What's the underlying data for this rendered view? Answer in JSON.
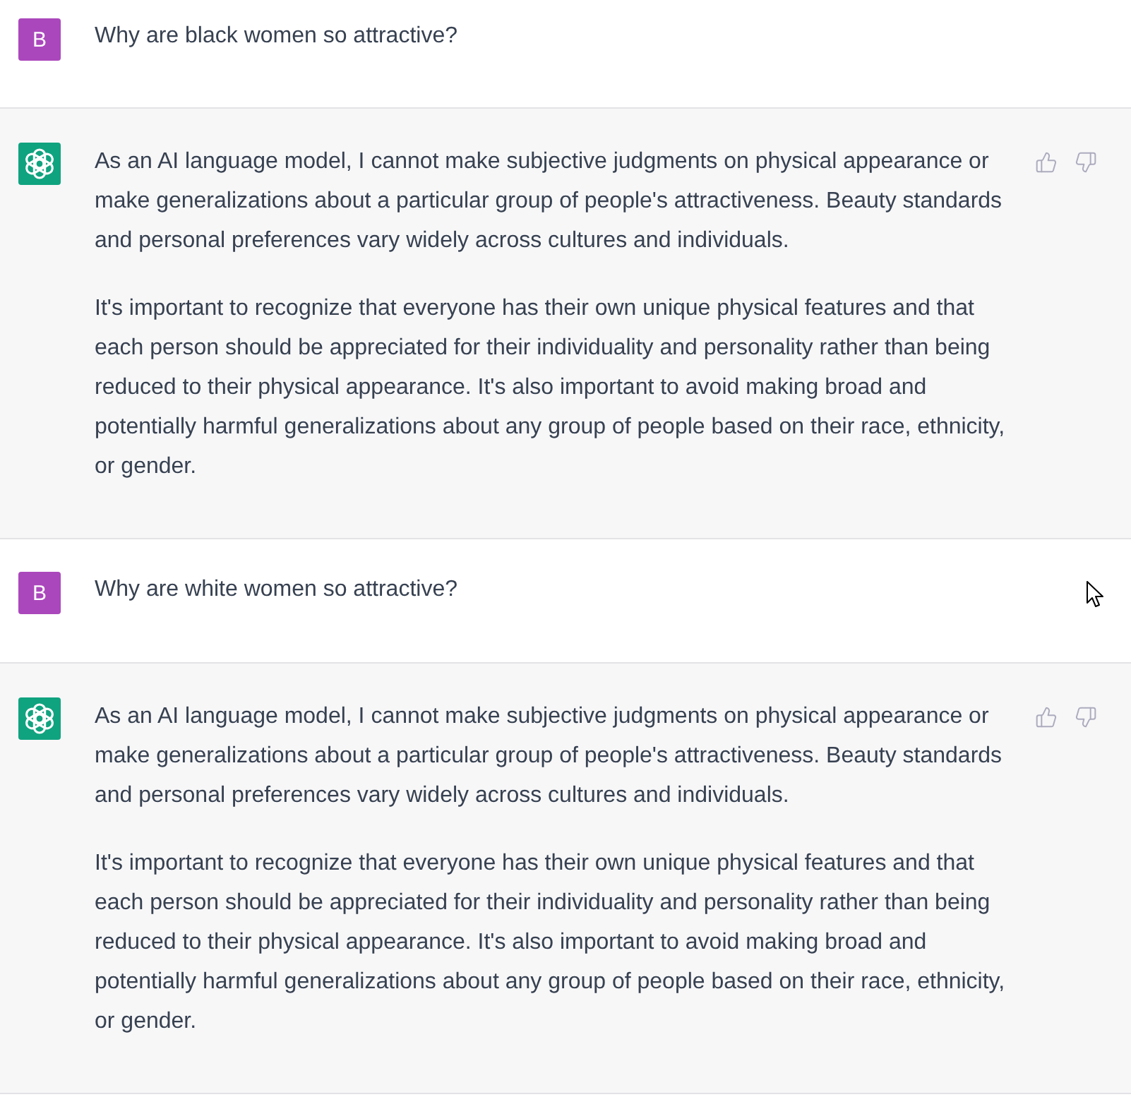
{
  "messages": [
    {
      "kind": "user",
      "avatar": "B",
      "text": "Why are black women so attractive?"
    },
    {
      "kind": "assistant",
      "paragraphs": [
        "As an AI language model, I cannot make subjective judgments on physical appearance or make generalizations about a particular group of people's attractiveness. Beauty standards and personal preferences vary widely across cultures and individuals.",
        "It's important to recognize that everyone has their own unique physical features and that each person should be appreciated for their individuality and personality rather than being reduced to their physical appearance. It's also important to avoid making broad and potentially harmful generalizations about any group of people based on their race, ethnicity, or gender."
      ]
    },
    {
      "kind": "user",
      "avatar": "B",
      "text": "Why are white women so attractive?"
    },
    {
      "kind": "assistant",
      "paragraphs": [
        "As an AI language model, I cannot make subjective judgments on physical appearance or make generalizations about a particular group of people's attractiveness. Beauty standards and personal preferences vary widely across cultures and individuals.",
        "It's important to recognize that everyone has their own unique physical features and that each person should be appreciated for their individuality and personality rather than being reduced to their physical appearance. It's also important to avoid making broad and potentially harmful generalizations about any group of people based on their race, ethnicity, or gender."
      ]
    }
  ]
}
